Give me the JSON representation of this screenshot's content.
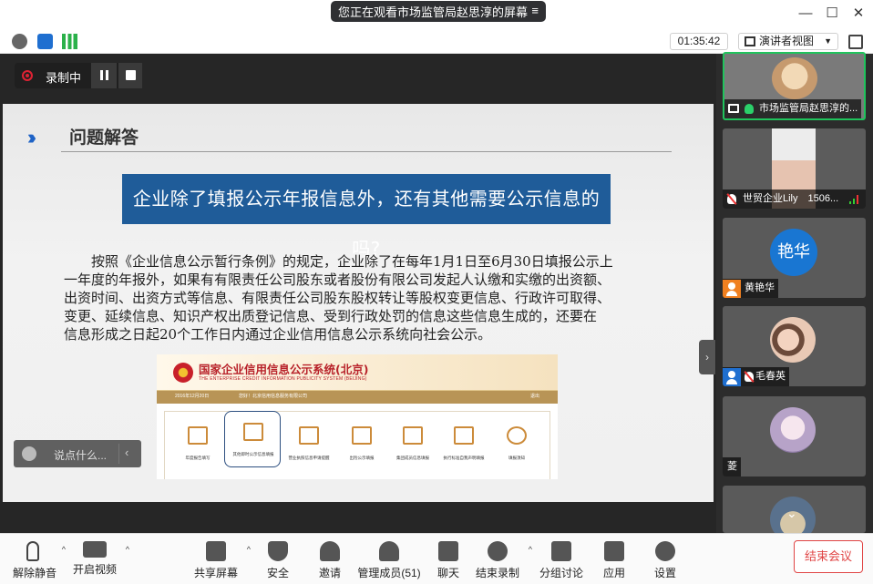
{
  "window": {
    "share_banner": "您正在观看市场监管局赵思淳的屏幕",
    "menu_icon": "≡",
    "minimize": "—",
    "maximize": "☐",
    "close": "✕"
  },
  "infobar": {
    "timer": "01:35:42",
    "view_mode": "演讲者视图"
  },
  "recording": {
    "label": "录制中"
  },
  "slide": {
    "section_title": "问题解答",
    "question": "企业除了填报公示年报信息外，还有其他需要公示信息的吗?",
    "paragraph_lines": [
      "按照《企业信息公示暂行条例》的规定，企业除了在每年1月1日至6月30日填报公示上",
      "一年度的年报外，如果有有限责任公司股东或者股份有限公司发起人认缴和实缴的出资额、",
      "出资时间、出资方式等信息、有限责任公司股东股权转让等股权变更信息、行政许可取得、",
      "变更、延续信息、知识产权出质登记信息、受到行政处罚的信息这些信息生成的，还要在",
      "信息形成之日起20个工作日内通过企业信用信息公示系统向社会公示。"
    ],
    "embedded": {
      "title": "国家企业信用信息公示系统(北京)",
      "subtitle": "THE ENTERPRISE CREDIT INFORMATION PUBLICITY SYSTEM (BEIJING)",
      "strip_left": "2016年12月20日",
      "strip_mid": "您好！北京信用信息服务有限公司",
      "strip_right": "退出",
      "tiles": [
        "年度报告填写",
        "其他即时公示信息填报",
        "营业执照信息申请提醒",
        "出险公示填报",
        "集团成员信息填报",
        "执行标准自我声明填报",
        "填报须知"
      ]
    }
  },
  "chat": {
    "placeholder": "说点什么...",
    "collapse": "‹"
  },
  "participants": [
    {
      "name": "市场监管局赵思淳的..."
    },
    {
      "name": "世贸企业Lily　1506..."
    },
    {
      "name": "黄艳华",
      "avatar_text": "艳华"
    },
    {
      "name": "毛春英"
    },
    {
      "name": "菱"
    },
    {
      "name": ""
    }
  ],
  "toolbar": {
    "mute": "解除静音",
    "video": "开启视频",
    "share": "共享屏幕",
    "security": "安全",
    "invite": "邀请",
    "members": "管理成员(51)",
    "chat": "聊天",
    "end_record": "结束录制",
    "breakout": "分组讨论",
    "apps": "应用",
    "settings": "设置",
    "end_meeting": "结束会议"
  },
  "colors": {
    "accent": "#1f5c99",
    "active_speaker": "#20c35c",
    "danger": "#e04545"
  }
}
